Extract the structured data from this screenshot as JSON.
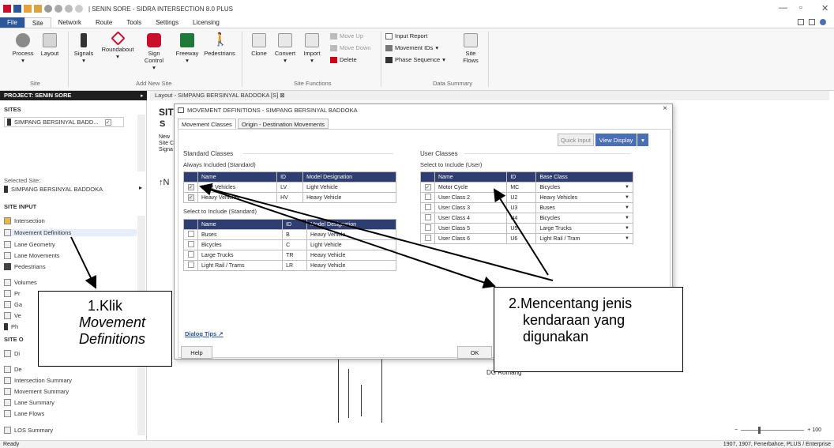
{
  "window": {
    "title": "| SENIN SORE - SIDRA INTERSECTION 8.0 PLUS",
    "controls": {
      "minimize": "—",
      "restore": "▫",
      "close": "✕"
    }
  },
  "menu": [
    "File",
    "Site",
    "Network",
    "Route",
    "Tools",
    "Settings",
    "Licensing"
  ],
  "ribbon": {
    "site_group": {
      "process": "Process",
      "layout": "Layout",
      "label": "Site"
    },
    "add_new_site": {
      "signals": "Signals",
      "roundabout": "Roundabout",
      "sign_control": "Sign Control",
      "freeway": "Freeway",
      "pedestrians": "Pedestrians",
      "label": "Add New Site"
    },
    "site_functions": {
      "clone": "Clone",
      "convert": "Convert",
      "import": "Import",
      "move_up": "Move Up",
      "move_down": "Move Down",
      "delete": "Delete",
      "label": "Site Functions"
    },
    "data_summary": {
      "input_report": "Input Report",
      "movement_ids": "Movement IDs",
      "phase_sequence": "Phase Sequence",
      "site_flows": "Site Flows",
      "label": "Data Summary"
    }
  },
  "left_panel": {
    "project_header": "PROJECT: SENIN SORE",
    "sites_header": "SITES",
    "site_item": "SIMPANG BERSINYAL BADD...",
    "selected_site_label": "Selected Site:",
    "selected_site_name": "SIMPANG BERSINYAL BADDOKA",
    "site_input_header": "SITE INPUT",
    "site_input_items": [
      "Intersection",
      "Movement Definitions",
      "Lane Geometry",
      "Lane Movements",
      "Pedestrians",
      "Volumes",
      "Pr",
      "Ga",
      "Ve",
      "Ph"
    ],
    "site_output_header": "SITE O",
    "site_output_items": [
      "Di",
      "De",
      "Intersection Summary",
      "Movement Summary",
      "Lane Summary",
      "Lane Flows",
      "LOS Summary"
    ]
  },
  "layout_tab": "Layout - SIMPANG BERSINYAL BADDOKA [S]",
  "canvas_fragments": {
    "sit": "SIT",
    "s": "S",
    "new": "New",
    "site_c": "Site C",
    "signa": "Signa",
    "north": "N",
    "dg_label": "DG Romang"
  },
  "dialog": {
    "title": "MOVEMENT DEFINITIONS - SIMPANG BERSINYAL BADDOKA",
    "tabs": [
      "Movement Classes",
      "Origin - Destination Movements"
    ],
    "quick_input": "Quick Input",
    "view_display": "View Display",
    "standard": {
      "heading": "Standard Classes",
      "always_label": "Always Included (Standard)",
      "columns": [
        "Name",
        "ID",
        "Model Designation"
      ],
      "always_rows": [
        {
          "name": "Light Vehicles",
          "id": "LV",
          "model": "Light Vehicle"
        },
        {
          "name": "Heavy Vehicles",
          "id": "HV",
          "model": "Heavy Vehicle"
        }
      ],
      "select_label": "Select to Include (Standard)",
      "select_rows": [
        {
          "name": "Buses",
          "id": "B",
          "model": "Heavy Vehicle"
        },
        {
          "name": "Bicycles",
          "id": "C",
          "model": "Light Vehicle"
        },
        {
          "name": "Large Trucks",
          "id": "TR",
          "model": "Heavy Vehicle"
        },
        {
          "name": "Light Rail / Trams",
          "id": "LR",
          "model": "Heavy Vehicle"
        }
      ]
    },
    "user": {
      "heading": "User Classes",
      "select_label": "Select to Include (User)",
      "columns": [
        "Name",
        "ID",
        "Base Class"
      ],
      "rows": [
        {
          "name": "Motor Cycle",
          "id": "MC",
          "base": "Bicycles",
          "checked": true
        },
        {
          "name": "User Class 2",
          "id": "U2",
          "base": "Heavy Vehicles",
          "checked": false
        },
        {
          "name": "User Class 3",
          "id": "U3",
          "base": "Buses",
          "checked": false
        },
        {
          "name": "User Class 4",
          "id": "U4",
          "base": "Bicycles",
          "checked": false
        },
        {
          "name": "User Class 5",
          "id": "U5",
          "base": "Large Trucks",
          "checked": false
        },
        {
          "name": "User Class 6",
          "id": "U6",
          "base": "Light Rail / Tram",
          "checked": false
        }
      ]
    },
    "dialog_tips": "Dialog Tips",
    "help": "Help",
    "ok": "OK"
  },
  "annotations": {
    "box1": {
      "line1": "1.Klik",
      "line2": "Movement",
      "line3": "Definitions"
    },
    "box2": {
      "line1": "2.Mencentang jenis",
      "line2": "kendaraan yang",
      "line3": "digunakan"
    }
  },
  "status": {
    "left": "Ready",
    "right": "1907, 1907, Fenerbahce, PLUS / Enterprise",
    "zoom": "+ 100"
  },
  "colors": {
    "table_header": "#2e3e70",
    "accent_blue": "#4a6fb5",
    "file_tab": "#2b579a"
  }
}
